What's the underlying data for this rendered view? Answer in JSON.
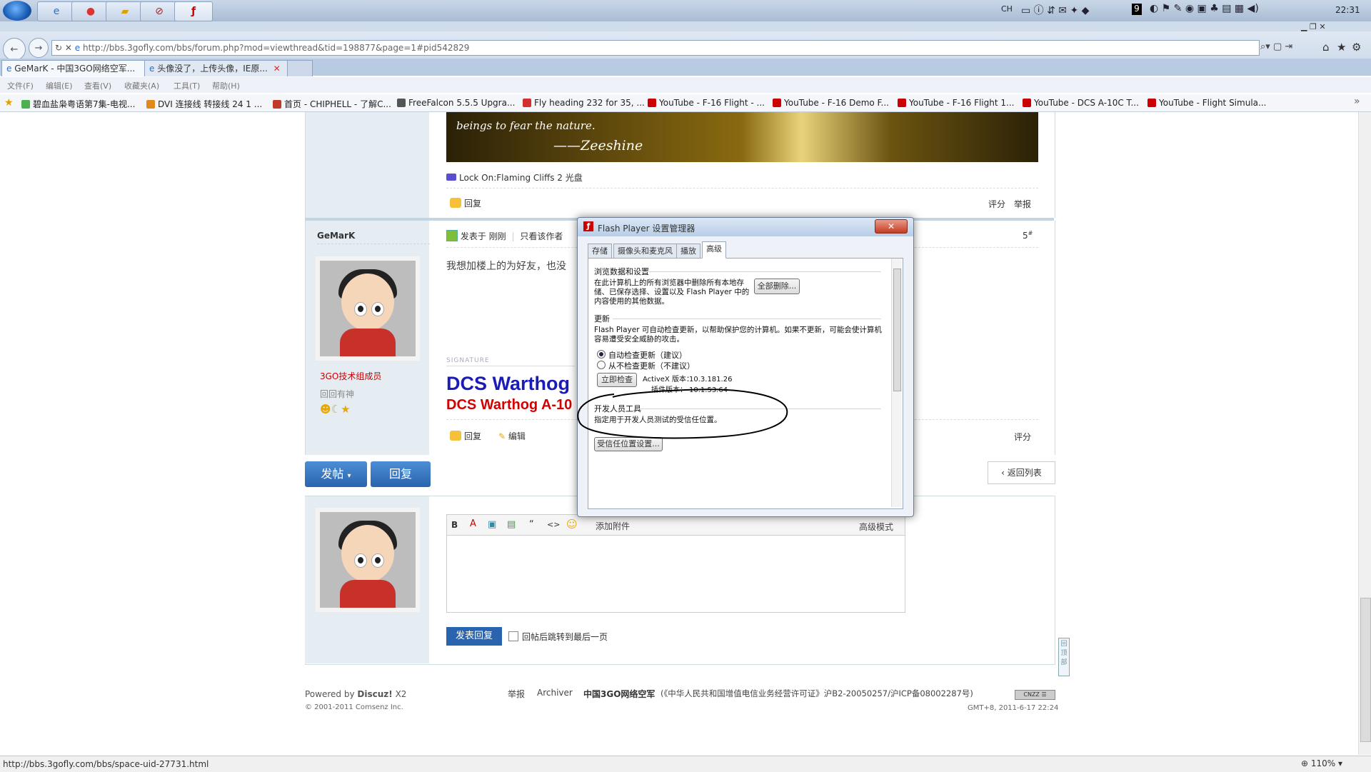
{
  "taskbar": {
    "time": "22:31",
    "lang": "CH",
    "tray_number": "9"
  },
  "browser": {
    "url": "http://bbs.3gofly.com/bbs/forum.php?mod=viewthread&tid=198877&page=1#pid542829",
    "tabs": [
      {
        "label": "GeMarK - 中国3GO网络空军..."
      },
      {
        "label": "头像没了，上传头像，IE原..."
      }
    ],
    "menu": [
      "文件(F)",
      "编辑(E)",
      "查看(V)",
      "收藏夹(A)",
      "工具(T)",
      "帮助(H)"
    ],
    "favorites": [
      {
        "label": "碧血盐枭粤语第7集-电视...",
        "color": "#4caf50"
      },
      {
        "label": "DVI 连接线 转接线 24 1 ...",
        "color": "#e08a1e"
      },
      {
        "label": "首页 - CHIPHELL - 了解C...",
        "color": "#c0392b"
      },
      {
        "label": "FreeFalcon 5.5.5 Upgra...",
        "color": "#555555"
      },
      {
        "label": "Fly heading 232 for 35, ...",
        "color": "#d32f2f"
      },
      {
        "label": "YouTube - F-16 Flight - ...",
        "color": "#cc0000"
      },
      {
        "label": "YouTube - F-16 Demo F...",
        "color": "#cc0000"
      },
      {
        "label": "YouTube - F-16 Flight 1...",
        "color": "#cc0000"
      },
      {
        "label": "YouTube - DCS A-10C T...",
        "color": "#cc0000"
      },
      {
        "label": "YouTube - Flight Simula...",
        "color": "#cc0000"
      }
    ]
  },
  "post_prev": {
    "banner_line1": "beings to fear the nature.",
    "banner_line2": "——Zeeshine",
    "link_label": "Lock On:Flaming Cliffs 2 光盘",
    "reply": "回复",
    "rate": "评分",
    "report": "举报"
  },
  "post": {
    "author": "GeMarK",
    "posted": "发表于 刚刚",
    "only_author": "只看该作者",
    "floor": "5",
    "floor_sup": "#",
    "body": "我想加楼上的为好友，也没",
    "role": "3GO技术组成员",
    "rank": "回回有神",
    "signature_label": "SIGNATURE",
    "sig_big": "DCS Warthog",
    "sig_red": "DCS Warthog A-10",
    "reply": "回复",
    "edit": "编辑",
    "rate": "评分"
  },
  "actions": {
    "new_post": "发帖",
    "reply": "回复",
    "back_to_list": "返回列表"
  },
  "editor": {
    "toolbar": [
      "B",
      "A",
      "▣",
      "▤",
      "“",
      "<>",
      "☺"
    ],
    "attach": "添加附件",
    "advanced": "高级模式",
    "submit": "发表回复",
    "jump_last": "回帖后跳转到最后一页"
  },
  "footer": {
    "powered": "Powered by",
    "brand": "Discuz!",
    "version": "X2",
    "copyright": "© 2001-2011 Comsenz Inc.",
    "links": [
      "举报",
      "Archiver"
    ],
    "site": "中国3GO网络空军",
    "license": "(《中华人民共和国增值电信业务经营许可证》沪B2-20050257/沪ICP备08002287号)",
    "time": "GMT+8, 2011-6-17 22:24"
  },
  "dialog": {
    "title": "Flash Player 设置管理器",
    "close": "✕",
    "tabs": [
      "存储",
      "摄像头和麦克风",
      "播放",
      "高级"
    ],
    "browse_section": "浏览数据和设置",
    "browse_text": "在此计算机上的所有浏览器中删除所有本地存储、已保存选择、设置以及 Flash Player 中的内容使用的其他数据。",
    "delete_all": "全部删除...",
    "update_section": "更新",
    "update_text": "Flash Player 可自动检查更新，以帮助保护您的计算机。如果不更新，可能会使计算机容易遭受安全威胁的攻击。",
    "auto_update": "自动检查更新（建议）",
    "no_update": "从不检查更新（不建议）",
    "check_now": "立即检查",
    "activex_label": "ActiveX 版本：",
    "activex_version": "10.3.181.26",
    "plugin_label": "插件版本：",
    "plugin_version": "10.1.53.64",
    "dev_section": "开发人员工具",
    "dev_text": "指定用于开发人员测试的受信任位置。",
    "trusted_btn": "受信任位置设置..."
  },
  "status": {
    "url": "http://bbs.3gofly.com/bbs/space-uid-27731.html",
    "zoom": "110%"
  }
}
